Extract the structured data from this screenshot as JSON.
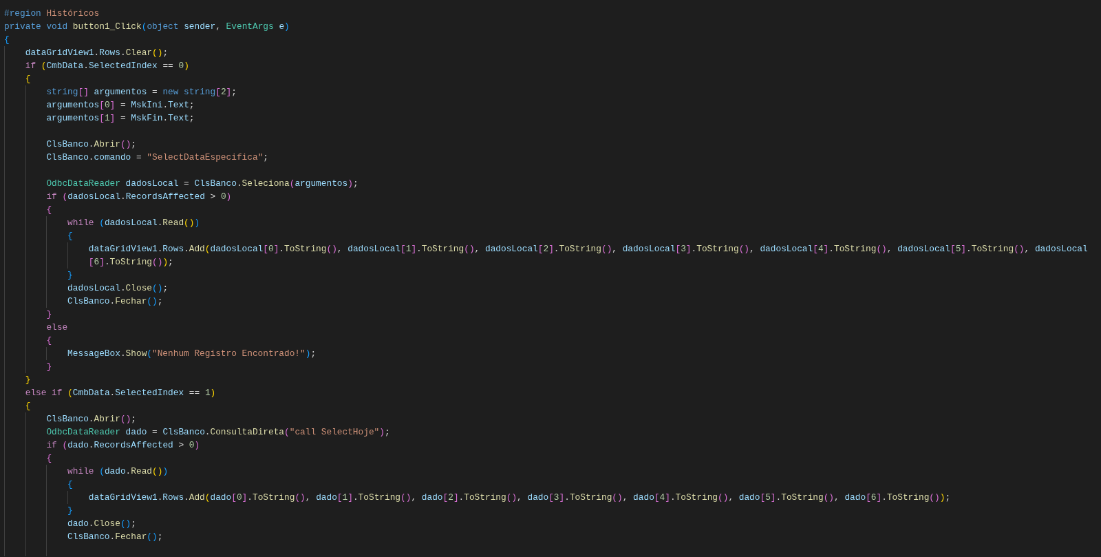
{
  "editor": {
    "lines": [
      {
        "kind": "code",
        "tokens": [
          {
            "kind": "kw",
            "text": "#region "
          },
          {
            "kind": "str",
            "text": "Históricos"
          }
        ]
      },
      {
        "kind": "code",
        "tokens": [
          {
            "kind": "kw",
            "text": "private void "
          },
          {
            "kind": "fn",
            "text": "button1_Click"
          },
          {
            "kind": "p",
            "text": "("
          },
          {
            "kind": "kw",
            "text": "object "
          },
          {
            "kind": "var",
            "text": "sender"
          },
          {
            "kind": "p",
            "text": ", "
          },
          {
            "kind": "type",
            "text": "EventArgs "
          },
          {
            "kind": "var",
            "text": "e"
          },
          {
            "kind": "p",
            "text": ")"
          }
        ]
      },
      {
        "kind": "code",
        "tokens": [
          {
            "kind": "p",
            "text": "{"
          }
        ],
        "children": [
          {
            "kind": "code",
            "tokens": [
              {
                "kind": "var",
                "text": "dataGridView1"
              },
              {
                "kind": "p",
                "text": "."
              },
              {
                "kind": "var",
                "text": "Rows"
              },
              {
                "kind": "p",
                "text": "."
              },
              {
                "kind": "fn",
                "text": "Clear"
              },
              {
                "kind": "p",
                "text": "();"
              }
            ]
          },
          {
            "kind": "code",
            "tokens": [
              {
                "kind": "ctl",
                "text": "if "
              },
              {
                "kind": "p",
                "text": "("
              },
              {
                "kind": "var",
                "text": "CmbData"
              },
              {
                "kind": "p",
                "text": "."
              },
              {
                "kind": "var",
                "text": "SelectedIndex"
              },
              {
                "kind": "p",
                "text": " == "
              },
              {
                "kind": "num",
                "text": "0"
              },
              {
                "kind": "p",
                "text": ")"
              }
            ]
          },
          {
            "kind": "code",
            "tokens": [
              {
                "kind": "p",
                "text": "{"
              }
            ],
            "children": [
              {
                "kind": "code",
                "tokens": [
                  {
                    "kind": "kw",
                    "text": "string"
                  },
                  {
                    "kind": "p",
                    "text": "[] "
                  },
                  {
                    "kind": "var",
                    "text": "argumentos"
                  },
                  {
                    "kind": "p",
                    "text": " = "
                  },
                  {
                    "kind": "kw",
                    "text": "new string"
                  },
                  {
                    "kind": "p",
                    "text": "["
                  },
                  {
                    "kind": "num",
                    "text": "2"
                  },
                  {
                    "kind": "p",
                    "text": "];"
                  }
                ]
              },
              {
                "kind": "code",
                "tokens": [
                  {
                    "kind": "var",
                    "text": "argumentos"
                  },
                  {
                    "kind": "p",
                    "text": "["
                  },
                  {
                    "kind": "num",
                    "text": "0"
                  },
                  {
                    "kind": "p",
                    "text": "] = "
                  },
                  {
                    "kind": "var",
                    "text": "MskIni"
                  },
                  {
                    "kind": "p",
                    "text": "."
                  },
                  {
                    "kind": "var",
                    "text": "Text"
                  },
                  {
                    "kind": "p",
                    "text": ";"
                  }
                ]
              },
              {
                "kind": "code",
                "tokens": [
                  {
                    "kind": "var",
                    "text": "argumentos"
                  },
                  {
                    "kind": "p",
                    "text": "["
                  },
                  {
                    "kind": "num",
                    "text": "1"
                  },
                  {
                    "kind": "p",
                    "text": "] = "
                  },
                  {
                    "kind": "var",
                    "text": "MskFin"
                  },
                  {
                    "kind": "p",
                    "text": "."
                  },
                  {
                    "kind": "var",
                    "text": "Text"
                  },
                  {
                    "kind": "p",
                    "text": ";"
                  }
                ]
              },
              {
                "kind": "blank"
              },
              {
                "kind": "code",
                "tokens": [
                  {
                    "kind": "var",
                    "text": "ClsBanco"
                  },
                  {
                    "kind": "p",
                    "text": "."
                  },
                  {
                    "kind": "fn",
                    "text": "Abrir"
                  },
                  {
                    "kind": "p",
                    "text": "();"
                  }
                ]
              },
              {
                "kind": "code",
                "tokens": [
                  {
                    "kind": "var",
                    "text": "ClsBanco"
                  },
                  {
                    "kind": "p",
                    "text": "."
                  },
                  {
                    "kind": "var",
                    "text": "comando"
                  },
                  {
                    "kind": "p",
                    "text": " = "
                  },
                  {
                    "kind": "str",
                    "text": "\"SelectDataEspecifica\""
                  },
                  {
                    "kind": "p",
                    "text": ";"
                  }
                ]
              },
              {
                "kind": "blank"
              },
              {
                "kind": "code",
                "tokens": [
                  {
                    "kind": "type",
                    "text": "OdbcDataReader "
                  },
                  {
                    "kind": "var",
                    "text": "dadosLocal"
                  },
                  {
                    "kind": "p",
                    "text": " = "
                  },
                  {
                    "kind": "var",
                    "text": "ClsBanco"
                  },
                  {
                    "kind": "p",
                    "text": "."
                  },
                  {
                    "kind": "fn",
                    "text": "Seleciona"
                  },
                  {
                    "kind": "p",
                    "text": "("
                  },
                  {
                    "kind": "var",
                    "text": "argumentos"
                  },
                  {
                    "kind": "p",
                    "text": ");"
                  }
                ]
              },
              {
                "kind": "code",
                "tokens": [
                  {
                    "kind": "ctl",
                    "text": "if "
                  },
                  {
                    "kind": "p",
                    "text": "("
                  },
                  {
                    "kind": "var",
                    "text": "dadosLocal"
                  },
                  {
                    "kind": "p",
                    "text": "."
                  },
                  {
                    "kind": "var",
                    "text": "RecordsAffected"
                  },
                  {
                    "kind": "p",
                    "text": " > "
                  },
                  {
                    "kind": "num",
                    "text": "0"
                  },
                  {
                    "kind": "p",
                    "text": ")"
                  }
                ]
              },
              {
                "kind": "code",
                "tokens": [
                  {
                    "kind": "p",
                    "text": "{"
                  }
                ],
                "children": [
                  {
                    "kind": "code",
                    "tokens": [
                      {
                        "kind": "ctl",
                        "text": "while "
                      },
                      {
                        "kind": "p",
                        "text": "("
                      },
                      {
                        "kind": "var",
                        "text": "dadosLocal"
                      },
                      {
                        "kind": "p",
                        "text": "."
                      },
                      {
                        "kind": "fn",
                        "text": "Read"
                      },
                      {
                        "kind": "p",
                        "text": "())"
                      }
                    ]
                  },
                  {
                    "kind": "code",
                    "tokens": [
                      {
                        "kind": "p",
                        "text": "{"
                      }
                    ],
                    "children": [
                      {
                        "kind": "code",
                        "tokens": [
                          {
                            "kind": "var",
                            "text": "dataGridView1"
                          },
                          {
                            "kind": "p",
                            "text": "."
                          },
                          {
                            "kind": "var",
                            "text": "Rows"
                          },
                          {
                            "kind": "p",
                            "text": "."
                          },
                          {
                            "kind": "fn",
                            "text": "Add"
                          },
                          {
                            "kind": "p",
                            "text": "("
                          },
                          {
                            "kind": "var",
                            "text": "dadosLocal"
                          },
                          {
                            "kind": "p",
                            "text": "["
                          },
                          {
                            "kind": "num",
                            "text": "0"
                          },
                          {
                            "kind": "p",
                            "text": "]."
                          },
                          {
                            "kind": "fn",
                            "text": "ToString"
                          },
                          {
                            "kind": "p",
                            "text": "(), "
                          },
                          {
                            "kind": "var",
                            "text": "dadosLocal"
                          },
                          {
                            "kind": "p",
                            "text": "["
                          },
                          {
                            "kind": "num",
                            "text": "1"
                          },
                          {
                            "kind": "p",
                            "text": "]."
                          },
                          {
                            "kind": "fn",
                            "text": "ToString"
                          },
                          {
                            "kind": "p",
                            "text": "(), "
                          },
                          {
                            "kind": "var",
                            "text": "dadosLocal"
                          },
                          {
                            "kind": "p",
                            "text": "["
                          },
                          {
                            "kind": "num",
                            "text": "2"
                          },
                          {
                            "kind": "p",
                            "text": "]."
                          },
                          {
                            "kind": "fn",
                            "text": "ToString"
                          },
                          {
                            "kind": "p",
                            "text": "(), "
                          },
                          {
                            "kind": "var",
                            "text": "dadosLocal"
                          },
                          {
                            "kind": "p",
                            "text": "["
                          },
                          {
                            "kind": "num",
                            "text": "3"
                          },
                          {
                            "kind": "p",
                            "text": "]."
                          },
                          {
                            "kind": "fn",
                            "text": "ToString"
                          },
                          {
                            "kind": "p",
                            "text": "(), "
                          },
                          {
                            "kind": "var",
                            "text": "dadosLocal"
                          },
                          {
                            "kind": "p",
                            "text": "["
                          },
                          {
                            "kind": "num",
                            "text": "4"
                          },
                          {
                            "kind": "p",
                            "text": "]."
                          },
                          {
                            "kind": "fn",
                            "text": "ToString"
                          },
                          {
                            "kind": "p",
                            "text": "(), "
                          },
                          {
                            "kind": "var",
                            "text": "dadosLocal"
                          },
                          {
                            "kind": "p",
                            "text": "["
                          },
                          {
                            "kind": "num",
                            "text": "5"
                          },
                          {
                            "kind": "p",
                            "text": "]."
                          },
                          {
                            "kind": "fn",
                            "text": "ToString"
                          },
                          {
                            "kind": "p",
                            "text": "(), "
                          },
                          {
                            "kind": "var",
                            "text": "dadosLocal"
                          }
                        ],
                        "wrap": [
                          {
                            "kind": "p",
                            "text": "["
                          },
                          {
                            "kind": "num",
                            "text": "6"
                          },
                          {
                            "kind": "p",
                            "text": "]."
                          },
                          {
                            "kind": "fn",
                            "text": "ToString"
                          },
                          {
                            "kind": "p",
                            "text": "());"
                          }
                        ]
                      }
                    ]
                  },
                  {
                    "kind": "code",
                    "tokens": [
                      {
                        "kind": "p",
                        "text": "}"
                      }
                    ]
                  },
                  {
                    "kind": "code",
                    "tokens": [
                      {
                        "kind": "var",
                        "text": "dadosLocal"
                      },
                      {
                        "kind": "p",
                        "text": "."
                      },
                      {
                        "kind": "fn",
                        "text": "Close"
                      },
                      {
                        "kind": "p",
                        "text": "();"
                      }
                    ]
                  },
                  {
                    "kind": "code",
                    "tokens": [
                      {
                        "kind": "var",
                        "text": "ClsBanco"
                      },
                      {
                        "kind": "p",
                        "text": "."
                      },
                      {
                        "kind": "fn",
                        "text": "Fechar"
                      },
                      {
                        "kind": "p",
                        "text": "();"
                      }
                    ]
                  }
                ]
              },
              {
                "kind": "code",
                "tokens": [
                  {
                    "kind": "p",
                    "text": "}"
                  }
                ]
              },
              {
                "kind": "code",
                "tokens": [
                  {
                    "kind": "ctl",
                    "text": "else"
                  }
                ]
              },
              {
                "kind": "code",
                "tokens": [
                  {
                    "kind": "p",
                    "text": "{"
                  }
                ],
                "children": [
                  {
                    "kind": "code",
                    "tokens": [
                      {
                        "kind": "var",
                        "text": "MessageBox"
                      },
                      {
                        "kind": "p",
                        "text": "."
                      },
                      {
                        "kind": "fn",
                        "text": "Show"
                      },
                      {
                        "kind": "p",
                        "text": "("
                      },
                      {
                        "kind": "str",
                        "text": "\"Nenhum Registro Encontrado!\""
                      },
                      {
                        "kind": "p",
                        "text": ");"
                      }
                    ]
                  }
                ]
              },
              {
                "kind": "code",
                "tokens": [
                  {
                    "kind": "p",
                    "text": "}"
                  }
                ]
              }
            ]
          },
          {
            "kind": "code",
            "tokens": [
              {
                "kind": "p",
                "text": "}"
              }
            ]
          },
          {
            "kind": "code",
            "tokens": [
              {
                "kind": "ctl",
                "text": "else if "
              },
              {
                "kind": "p",
                "text": "("
              },
              {
                "kind": "var",
                "text": "CmbData"
              },
              {
                "kind": "p",
                "text": "."
              },
              {
                "kind": "var",
                "text": "SelectedIndex"
              },
              {
                "kind": "p",
                "text": " == "
              },
              {
                "kind": "num",
                "text": "1"
              },
              {
                "kind": "p",
                "text": ")"
              }
            ]
          },
          {
            "kind": "code",
            "tokens": [
              {
                "kind": "p",
                "text": "{"
              }
            ],
            "children": [
              {
                "kind": "code",
                "tokens": [
                  {
                    "kind": "var",
                    "text": "ClsBanco"
                  },
                  {
                    "kind": "p",
                    "text": "."
                  },
                  {
                    "kind": "fn",
                    "text": "Abrir"
                  },
                  {
                    "kind": "p",
                    "text": "();"
                  }
                ]
              },
              {
                "kind": "code",
                "tokens": [
                  {
                    "kind": "type",
                    "text": "OdbcDataReader "
                  },
                  {
                    "kind": "var",
                    "text": "dado"
                  },
                  {
                    "kind": "p",
                    "text": " = "
                  },
                  {
                    "kind": "var",
                    "text": "ClsBanco"
                  },
                  {
                    "kind": "p",
                    "text": "."
                  },
                  {
                    "kind": "fn",
                    "text": "ConsultaDireta"
                  },
                  {
                    "kind": "p",
                    "text": "("
                  },
                  {
                    "kind": "str",
                    "text": "\"call SelectHoje\""
                  },
                  {
                    "kind": "p",
                    "text": ");"
                  }
                ]
              },
              {
                "kind": "code",
                "tokens": [
                  {
                    "kind": "ctl",
                    "text": "if "
                  },
                  {
                    "kind": "p",
                    "text": "("
                  },
                  {
                    "kind": "var",
                    "text": "dado"
                  },
                  {
                    "kind": "p",
                    "text": "."
                  },
                  {
                    "kind": "var",
                    "text": "RecordsAffected"
                  },
                  {
                    "kind": "p",
                    "text": " > "
                  },
                  {
                    "kind": "num",
                    "text": "0"
                  },
                  {
                    "kind": "p",
                    "text": ")"
                  }
                ]
              },
              {
                "kind": "code",
                "tokens": [
                  {
                    "kind": "p",
                    "text": "{"
                  }
                ],
                "children": [
                  {
                    "kind": "code",
                    "tokens": [
                      {
                        "kind": "ctl",
                        "text": "while "
                      },
                      {
                        "kind": "p",
                        "text": "("
                      },
                      {
                        "kind": "var",
                        "text": "dado"
                      },
                      {
                        "kind": "p",
                        "text": "."
                      },
                      {
                        "kind": "fn",
                        "text": "Read"
                      },
                      {
                        "kind": "p",
                        "text": "())"
                      }
                    ]
                  },
                  {
                    "kind": "code",
                    "tokens": [
                      {
                        "kind": "p",
                        "text": "{"
                      }
                    ],
                    "children": [
                      {
                        "kind": "code",
                        "tokens": [
                          {
                            "kind": "var",
                            "text": "dataGridView1"
                          },
                          {
                            "kind": "p",
                            "text": "."
                          },
                          {
                            "kind": "var",
                            "text": "Rows"
                          },
                          {
                            "kind": "p",
                            "text": "."
                          },
                          {
                            "kind": "fn",
                            "text": "Add"
                          },
                          {
                            "kind": "p",
                            "text": "("
                          },
                          {
                            "kind": "var",
                            "text": "dado"
                          },
                          {
                            "kind": "p",
                            "text": "["
                          },
                          {
                            "kind": "num",
                            "text": "0"
                          },
                          {
                            "kind": "p",
                            "text": "]."
                          },
                          {
                            "kind": "fn",
                            "text": "ToString"
                          },
                          {
                            "kind": "p",
                            "text": "(), "
                          },
                          {
                            "kind": "var",
                            "text": "dado"
                          },
                          {
                            "kind": "p",
                            "text": "["
                          },
                          {
                            "kind": "num",
                            "text": "1"
                          },
                          {
                            "kind": "p",
                            "text": "]."
                          },
                          {
                            "kind": "fn",
                            "text": "ToString"
                          },
                          {
                            "kind": "p",
                            "text": "(), "
                          },
                          {
                            "kind": "var",
                            "text": "dado"
                          },
                          {
                            "kind": "p",
                            "text": "["
                          },
                          {
                            "kind": "num",
                            "text": "2"
                          },
                          {
                            "kind": "p",
                            "text": "]."
                          },
                          {
                            "kind": "fn",
                            "text": "ToString"
                          },
                          {
                            "kind": "p",
                            "text": "(), "
                          },
                          {
                            "kind": "var",
                            "text": "dado"
                          },
                          {
                            "kind": "p",
                            "text": "["
                          },
                          {
                            "kind": "num",
                            "text": "3"
                          },
                          {
                            "kind": "p",
                            "text": "]."
                          },
                          {
                            "kind": "fn",
                            "text": "ToString"
                          },
                          {
                            "kind": "p",
                            "text": "(), "
                          },
                          {
                            "kind": "var",
                            "text": "dado"
                          },
                          {
                            "kind": "p",
                            "text": "["
                          },
                          {
                            "kind": "num",
                            "text": "4"
                          },
                          {
                            "kind": "p",
                            "text": "]."
                          },
                          {
                            "kind": "fn",
                            "text": "ToString"
                          },
                          {
                            "kind": "p",
                            "text": "(), "
                          },
                          {
                            "kind": "var",
                            "text": "dado"
                          },
                          {
                            "kind": "p",
                            "text": "["
                          },
                          {
                            "kind": "num",
                            "text": "5"
                          },
                          {
                            "kind": "p",
                            "text": "]."
                          },
                          {
                            "kind": "fn",
                            "text": "ToString"
                          },
                          {
                            "kind": "p",
                            "text": "(), "
                          },
                          {
                            "kind": "var",
                            "text": "dado"
                          },
                          {
                            "kind": "p",
                            "text": "["
                          },
                          {
                            "kind": "num",
                            "text": "6"
                          },
                          {
                            "kind": "p",
                            "text": "]."
                          },
                          {
                            "kind": "fn",
                            "text": "ToString"
                          },
                          {
                            "kind": "p",
                            "text": "());"
                          }
                        ]
                      }
                    ]
                  },
                  {
                    "kind": "code",
                    "tokens": [
                      {
                        "kind": "p",
                        "text": "}"
                      }
                    ]
                  },
                  {
                    "kind": "code",
                    "tokens": [
                      {
                        "kind": "var",
                        "text": "dado"
                      },
                      {
                        "kind": "p",
                        "text": "."
                      },
                      {
                        "kind": "fn",
                        "text": "Close"
                      },
                      {
                        "kind": "p",
                        "text": "();"
                      }
                    ]
                  },
                  {
                    "kind": "code",
                    "tokens": [
                      {
                        "kind": "var",
                        "text": "ClsBanco"
                      },
                      {
                        "kind": "p",
                        "text": "."
                      },
                      {
                        "kind": "fn",
                        "text": "Fechar"
                      },
                      {
                        "kind": "p",
                        "text": "();"
                      }
                    ]
                  },
                  {
                    "kind": "blank"
                  }
                ]
              }
            ]
          }
        ]
      }
    ]
  }
}
